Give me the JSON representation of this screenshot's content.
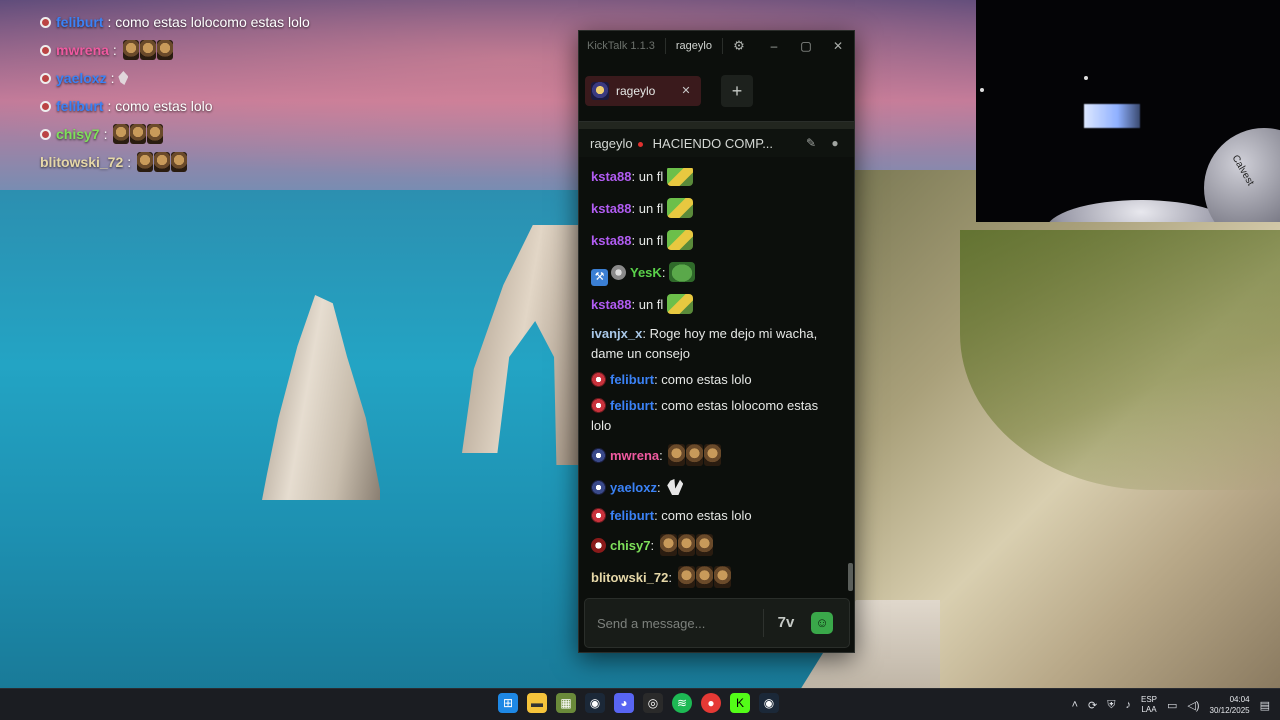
{
  "overlay": {
    "lines": [
      {
        "user": "feliburt",
        "text": "como estas lolocomo estas lolo",
        "color": "#3b82f6"
      },
      {
        "user": "mwrena",
        "text": "",
        "color": "#ef5aa0"
      },
      {
        "user": "yaeloxz",
        "text": "",
        "color": "#3b82f6"
      },
      {
        "user": "feliburt",
        "text": "como estas lolo",
        "color": "#3b82f6"
      },
      {
        "user": "chisy7",
        "text": "",
        "color": "#7ee05a"
      },
      {
        "user": "blitowski_72",
        "text": "",
        "color": "#e6d8a8"
      }
    ]
  },
  "app": {
    "title": "KickTalk 1.1.3",
    "current_channel": "rageylo",
    "window_buttons": {
      "minimize": "–",
      "maximize": "▢",
      "close": "✕"
    },
    "tab": {
      "label": "rageylo",
      "close": "✕"
    },
    "add_tab": "+",
    "header": {
      "channel": "rageylo",
      "stream_title": "HACIENDO COMP..."
    },
    "messages": [
      {
        "user": "ksta88",
        "text": "un fl",
        "color": "#b15cf2"
      },
      {
        "user": "ksta88",
        "text": "un fl",
        "color": "#b15cf2"
      },
      {
        "user": "ksta88",
        "text": "un fl",
        "color": "#b15cf2"
      },
      {
        "user": "YesK",
        "text": "",
        "color": "#5ad14a"
      },
      {
        "user": "ksta88",
        "text": "un fl",
        "color": "#b15cf2"
      },
      {
        "user": "ivanjx_x",
        "text": "Roge hoy me dejo mi wacha, dame un consejo",
        "color": "#a9c8e8"
      },
      {
        "user": "feliburt",
        "text": "como estas lolo",
        "color": "#3b82f6"
      },
      {
        "user": "feliburt",
        "text": "como estas lolocomo estas lolo",
        "color": "#3b82f6"
      },
      {
        "user": "mwrena",
        "text": "",
        "color": "#ef5aa0"
      },
      {
        "user": "yaeloxz",
        "text": "",
        "color": "#3b82f6"
      },
      {
        "user": "feliburt",
        "text": "como estas lolo",
        "color": "#3b82f6"
      },
      {
        "user": "chisy7",
        "text": "",
        "color": "#7ee05a"
      },
      {
        "user": "blitowski_72",
        "text": "",
        "color": "#e6d8a8"
      }
    ],
    "input": {
      "placeholder": "Send a message..."
    }
  },
  "taskbar": {
    "language": "ESP",
    "language_sub": "LAA",
    "time": "04:04",
    "date": "30/12/2025"
  },
  "webcam": {
    "mic_label": "Calvest"
  }
}
